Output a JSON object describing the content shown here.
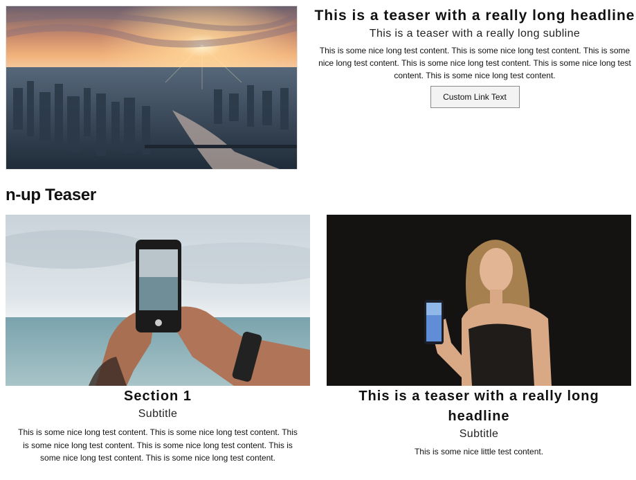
{
  "hero": {
    "headline": "This is a teaser with a really long headline",
    "subline": "This is a teaser with a really long subline",
    "body": "This is some nice long test content. This is some nice long test content. This is some nice long test content. This is some nice long test content. This is some nice long test content. This is some nice long test content.",
    "cta_label": "Custom Link Text",
    "image_alt": "city-skyline-sunset"
  },
  "nup": {
    "heading": "n-up Teaser",
    "cards": [
      {
        "title": "Section 1",
        "subtitle": "Subtitle",
        "body": "This is some nice long test content. This is some nice long test content. This is some nice long test content. This is some nice long test content. This is some nice long test content. This is some nice long test content.",
        "image_alt": "hands-holding-phone-over-sea"
      },
      {
        "title": "This is a teaser with a really long headline",
        "subtitle": "Subtitle",
        "body": "This is some nice little test content.",
        "image_alt": "woman-holding-smartphone"
      }
    ]
  },
  "colors": {
    "text": "#111111",
    "button_border": "#8a8a8a",
    "button_bg": "#f3f3f3"
  }
}
